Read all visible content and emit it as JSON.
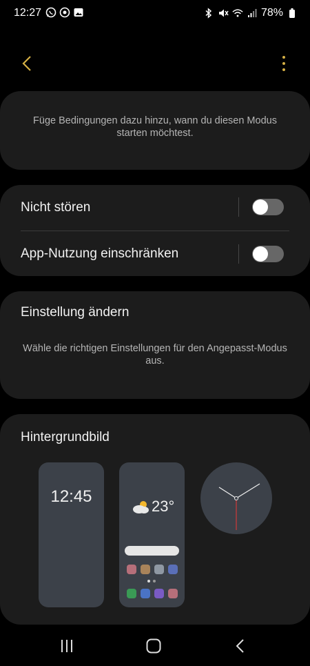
{
  "status_bar": {
    "time": "12:27",
    "battery": "78%"
  },
  "conditions_card": {
    "description": "Füge Bedingungen dazu hinzu, wann du diesen Modus starten möchtest."
  },
  "toggles": [
    {
      "label": "Nicht stören",
      "on": false
    },
    {
      "label": "App-Nutzung einschränken",
      "on": false
    }
  ],
  "settings_card": {
    "title": "Einstellung ändern",
    "description": "Wähle die richtigen Einstellungen für den Angepasst-Modus aus."
  },
  "wallpaper_card": {
    "title": "Hintergrundbild",
    "lock_time": "12:45",
    "temperature": "23°"
  },
  "colors": {
    "accent": "#d5b045",
    "card": "#1c1c1c",
    "preview": "#3c4149"
  }
}
